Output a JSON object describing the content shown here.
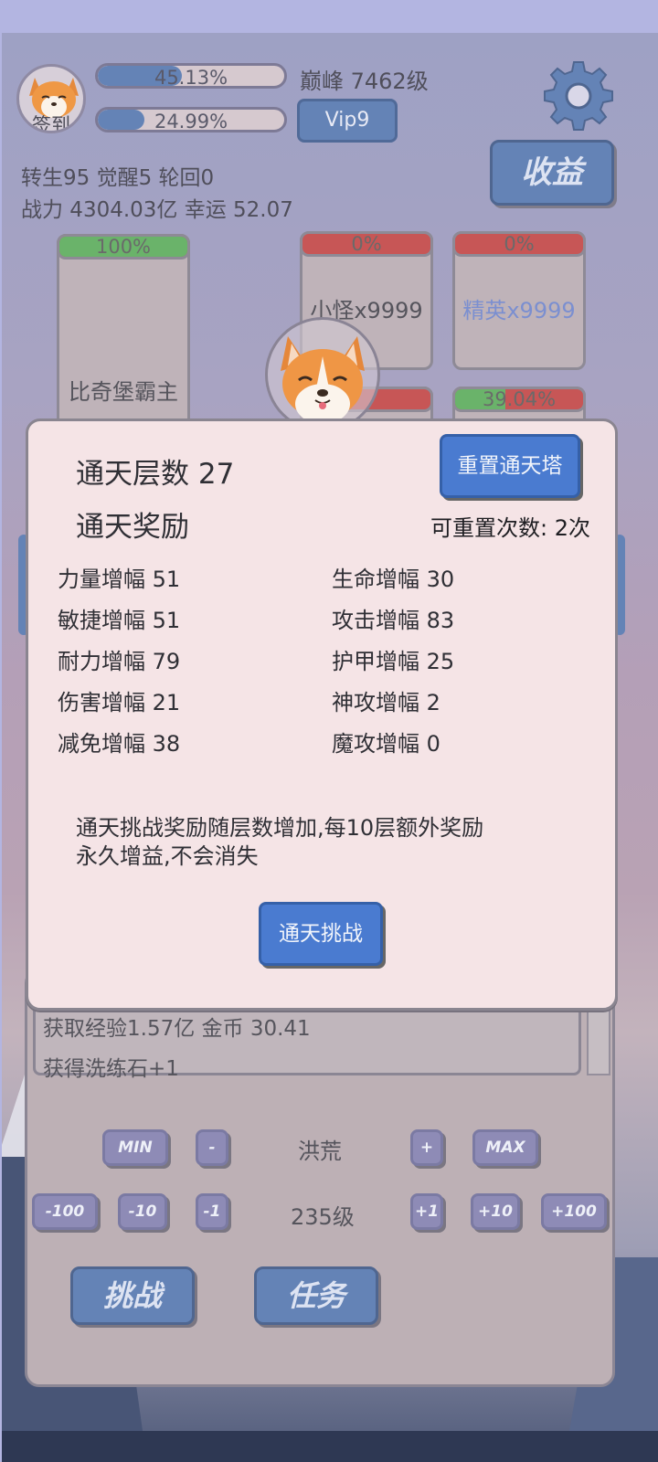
{
  "header": {
    "checkin_label": "签到",
    "exp_bar": {
      "text": "45.13%",
      "fill": 0.4513
    },
    "sub_bar": {
      "text": "24.99%",
      "fill": 0.2499
    },
    "peak_level": "巅峰 7462级",
    "vip_label": "Vip9",
    "income_label": "收益",
    "stats_line1": "转生95 觉醒5 轮回0",
    "stats_line2": "战力 4304.03亿  幸运 52.07"
  },
  "enemies": {
    "boss": {
      "name": "比奇堡霸主",
      "hp_text": "100%",
      "hp": 1.0
    },
    "minion": {
      "name": "小怪x9999",
      "hp_text": "0%",
      "hp": 0.0
    },
    "elite": {
      "name": "精英x9999",
      "hp_text": "0%",
      "hp": 0.0
    },
    "slot4": {
      "hp_text": "",
      "hp": 0.0
    },
    "slot5": {
      "hp_text": "39.04%",
      "hp": 0.3904
    }
  },
  "log": {
    "line1": "获取经验1.57亿 金币 30.41",
    "line2": "获得洗练石+1"
  },
  "controls": {
    "min_label": "MIN",
    "minus_label": "-",
    "realm": "洪荒",
    "plus_label": "+",
    "max_label": "MAX",
    "m100": "-100",
    "m10": "-10",
    "m1": "-1",
    "level": "235级",
    "p1": "+1",
    "p10": "+10",
    "p100": "+100",
    "challenge_label": "挑战",
    "task_label": "任务"
  },
  "dialog": {
    "floor": "通天层数 27",
    "reward_title": "通天奖励",
    "reset_button": "重置通天塔",
    "reset_count": "可重置次数: 2次",
    "stats": [
      "力量增幅 51",
      "生命增幅 30",
      "敏捷增幅 51",
      "攻击增幅 83",
      "耐力增幅 79",
      "护甲增幅 25",
      "伤害增幅 21",
      "神攻增幅 2",
      "减免增幅 38",
      "魔攻增幅 0"
    ],
    "desc_line1": "通天挑战奖励随层数增加,每10层额外奖励",
    "desc_line2": "永久增益,不会消失",
    "challenge_button": "通天挑战"
  },
  "colors": {
    "accent_blue": "#6483b6",
    "dialog_button_blue": "#4a7bd0",
    "hp_green": "#6ab36a",
    "hp_red": "#c75656",
    "elite_name": "#7b8fd0"
  }
}
